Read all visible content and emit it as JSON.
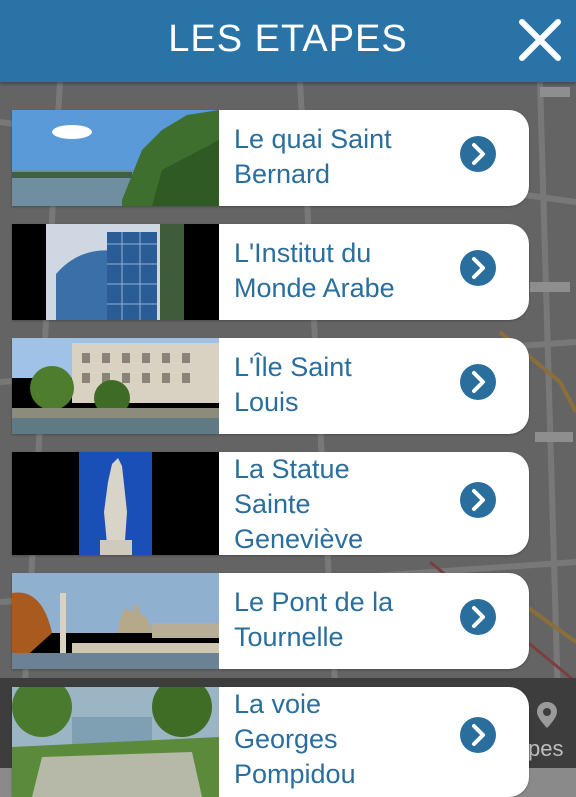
{
  "header": {
    "title": "LES ETAPES"
  },
  "colors": {
    "header_bg": "#2a73a6",
    "accent": "#2a6e9e",
    "card_bg": "#ffffff"
  },
  "steps": [
    {
      "title_line1": "Le quai Saint",
      "title_line2": "Bernard",
      "title_line3": ""
    },
    {
      "title_line1": "L'Institut du",
      "title_line2": "Monde Arabe",
      "title_line3": ""
    },
    {
      "title_line1": "L'Île Saint",
      "title_line2": "Louis",
      "title_line3": ""
    },
    {
      "title_line1": "La Statue",
      "title_line2": "Sainte",
      "title_line3": "Geneviève"
    },
    {
      "title_line1": "Le Pont de la",
      "title_line2": "Tournelle",
      "title_line3": ""
    },
    {
      "title_line1": "La voie",
      "title_line2": "Georges",
      "title_line3": "Pompidou"
    }
  ],
  "bottom_tab": {
    "label": "pes",
    "icon": "map-pin-icon"
  },
  "icons": {
    "close": "close-icon",
    "chevron": "chevron-right-icon"
  }
}
